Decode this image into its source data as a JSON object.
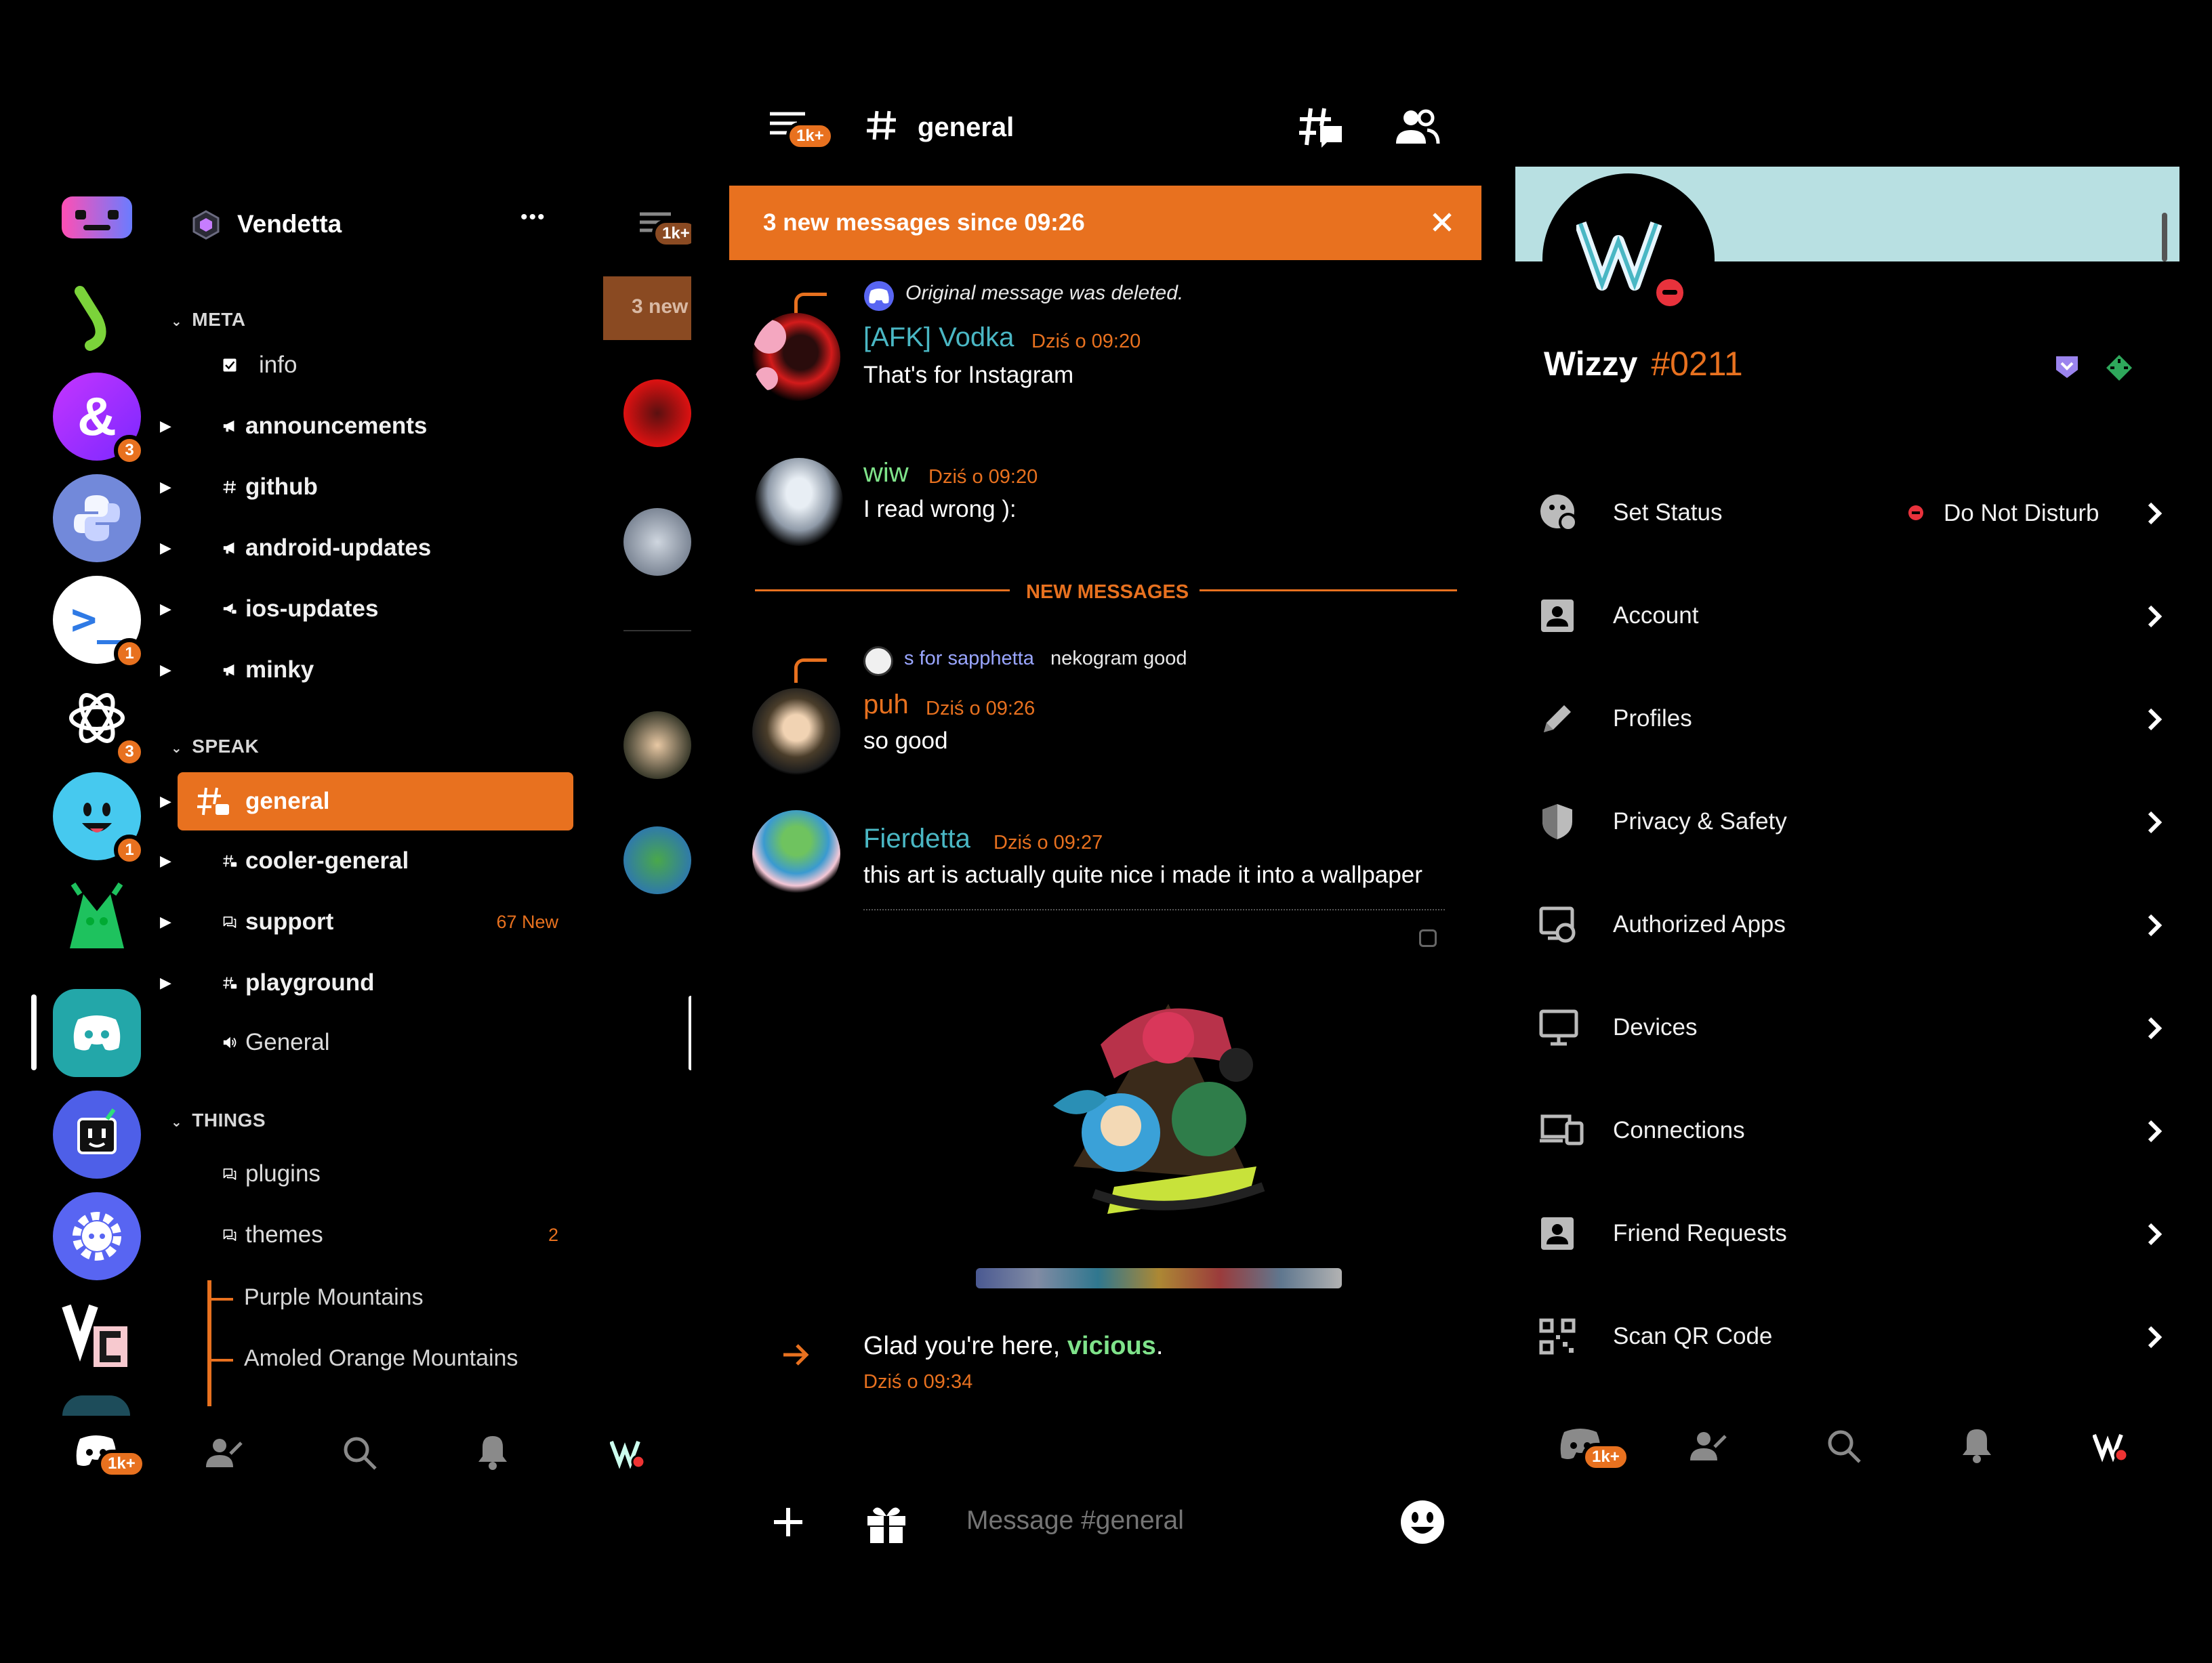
{
  "colors": {
    "accent": "#e8711f",
    "background": "#000000",
    "profile_banner": "#b8e0e2"
  },
  "servers": [
    {
      "name": "vendetta-logo-server",
      "badge": ""
    },
    {
      "name": "green-arc-server",
      "badge": ""
    },
    {
      "name": "ampersand-server",
      "badge": "3"
    },
    {
      "name": "python-server",
      "badge": ""
    },
    {
      "name": "terminal-server",
      "badge": "1"
    },
    {
      "name": "openai-server",
      "badge": "3"
    },
    {
      "name": "smiley-server",
      "badge": "1"
    },
    {
      "name": "green-character-server",
      "badge": ""
    },
    {
      "name": "teal-discord-server",
      "badge": ""
    },
    {
      "name": "bot-server",
      "badge": ""
    },
    {
      "name": "gear-server",
      "badge": ""
    },
    {
      "name": "vc-server",
      "badge": ""
    }
  ],
  "guild": {
    "name": "Vendetta",
    "more": "•••"
  },
  "categories": {
    "meta": "META",
    "speak": "SPEAK",
    "things": "THINGS"
  },
  "channels": {
    "info": "info",
    "announcements": "announcements",
    "github": "github",
    "android_updates": "android-updates",
    "ios_updates": "ios-updates",
    "minky": "minky",
    "general": "general",
    "cooler_general": "cooler-general",
    "support": "support",
    "support_new": "67 New",
    "playground": "playground",
    "general_voice": "General",
    "plugins": "plugins",
    "themes": "themes",
    "themes_count": "2",
    "thread_1": "Purple Mountains",
    "thread_2": "Amoled Orange Mountains"
  },
  "peek": {
    "badge": "1k+",
    "banner": "3 new"
  },
  "left_nav": {
    "home_badge": "1k+"
  },
  "chat": {
    "channel_name": "general",
    "header_badge": "1k+",
    "banner_text": "3 new messages since 09:26",
    "new_messages_divider": "NEW MESSAGES",
    "messages": [
      {
        "reply": "Original message was deleted.",
        "author": "[AFK] Vodka",
        "author_color": "#4ab7c4",
        "time": "Dziś o 09:20",
        "text": "That's for Instagram"
      },
      {
        "author": "wiw",
        "author_color": "#7fe38a",
        "time": "Dziś o 09:20",
        "text": "I read wrong ):"
      },
      {
        "reply_author": "s for sapphetta",
        "reply": "nekogram good",
        "author": "puh",
        "author_color": "#e8711f",
        "time": "Dziś o 09:26",
        "text": "so good"
      },
      {
        "author": "Fierdetta",
        "author_color": "#4ab7c4",
        "time": "Dziś o 09:27",
        "text": "this art is actually quite nice i made it into a wallpaper"
      }
    ],
    "join": {
      "prefix": "Glad you're here, ",
      "name": "vicious",
      "suffix": ".",
      "time": "Dziś o 09:34"
    },
    "input_placeholder": "Message #general"
  },
  "profile": {
    "username": "Wizzy",
    "discriminator": "#0211"
  },
  "settings": {
    "set_status": "Set Status",
    "status_value": "Do Not Disturb",
    "account": "Account",
    "profiles": "Profiles",
    "privacy": "Privacy & Safety",
    "authorized_apps": "Authorized Apps",
    "devices": "Devices",
    "connections": "Connections",
    "friend_requests": "Friend Requests",
    "scan_qr": "Scan QR Code"
  },
  "right_nav": {
    "home_badge": "1k+"
  }
}
